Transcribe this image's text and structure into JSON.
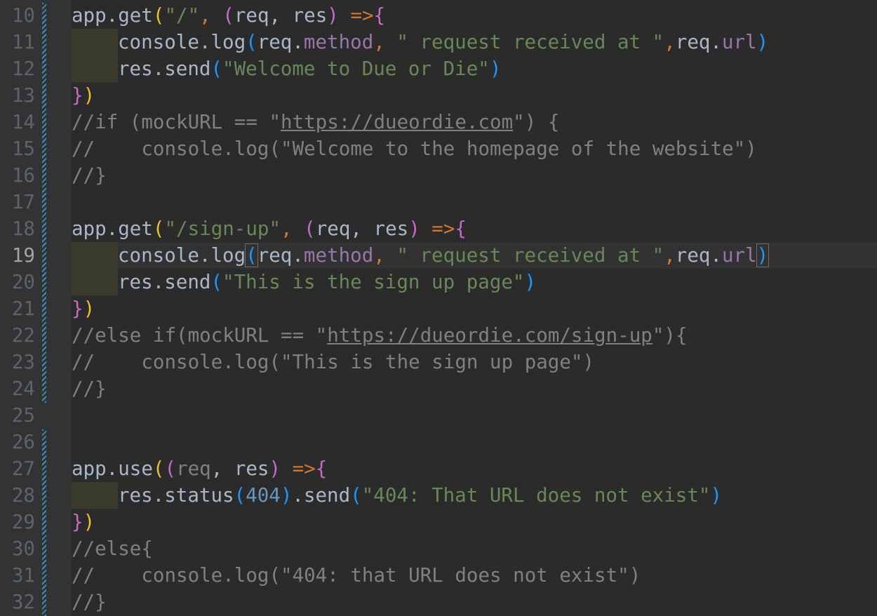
{
  "editor": {
    "lines": [
      {
        "n": "10",
        "t": [
          "app.get",
          "(",
          "\"/\"",
          ",",
          " ",
          "(",
          "req, res",
          ")",
          " =>",
          "{"
        ]
      },
      {
        "n": "11",
        "t": [
          "console.log",
          "(",
          "req.",
          "method",
          ",",
          "\" request received at \"",
          ",",
          "req.",
          "url",
          ")"
        ]
      },
      {
        "n": "12",
        "t": [
          "res.send",
          "(",
          "\"Welcome to Due or Die\"",
          ")"
        ]
      },
      {
        "n": "13",
        "t": [
          "}",
          ")"
        ]
      },
      {
        "n": "14",
        "t": [
          "//if (mockURL == \"",
          "https://dueordie.com",
          "\") {"
        ]
      },
      {
        "n": "15",
        "t": [
          "//    console.log(\"Welcome to the homepage of the website\")"
        ]
      },
      {
        "n": "16",
        "t": [
          "//}"
        ]
      },
      {
        "n": "17",
        "t": []
      },
      {
        "n": "18",
        "t": [
          "app.get",
          "(",
          "\"/sign-up\"",
          ",",
          " ",
          "(",
          "req, res",
          ")",
          " =>",
          "{"
        ]
      },
      {
        "n": "19",
        "t": [
          "console.log",
          "(",
          "req.",
          "method",
          ",",
          "\" request received at \"",
          ",",
          "req.",
          "url",
          ")"
        ]
      },
      {
        "n": "20",
        "t": [
          "res.send",
          "(",
          "\"This is the sign up page\"",
          ")"
        ]
      },
      {
        "n": "21",
        "t": [
          "}",
          ")"
        ]
      },
      {
        "n": "22",
        "t": [
          "//else if(mockURL == \"",
          "https://dueordie.com/sign-up",
          "\"){"
        ]
      },
      {
        "n": "23",
        "t": [
          "//    console.log(\"This is the sign up page\")"
        ]
      },
      {
        "n": "24",
        "t": [
          "//}"
        ]
      },
      {
        "n": "25",
        "t": []
      },
      {
        "n": "26",
        "t": []
      },
      {
        "n": "27",
        "t": [
          "app.use",
          "(",
          "(",
          "req",
          ", res",
          ")",
          " =>",
          "{"
        ]
      },
      {
        "n": "28",
        "t": [
          "res.status",
          "(",
          "404",
          ")",
          ".send",
          "(",
          "\"404: That URL does not exist\"",
          ")"
        ]
      },
      {
        "n": "29",
        "t": [
          "}",
          ")"
        ]
      },
      {
        "n": "30",
        "t": [
          "//else{"
        ]
      },
      {
        "n": "31",
        "t": [
          "//    console.log(\"404: that URL does not exist\")"
        ]
      },
      {
        "n": "32",
        "t": [
          "//}"
        ]
      }
    ],
    "current_line": "19",
    "colors": {
      "background": "#2b2b2b",
      "gutter": "#313335",
      "comment": "#808080",
      "string": "#6a8759",
      "property": "#9876aa",
      "keyword": "#cc7832",
      "number": "#6897bb",
      "bracket_yellow": "#e6c229",
      "bracket_pink": "#c36bc7",
      "bracket_blue": "#2196f3"
    }
  }
}
